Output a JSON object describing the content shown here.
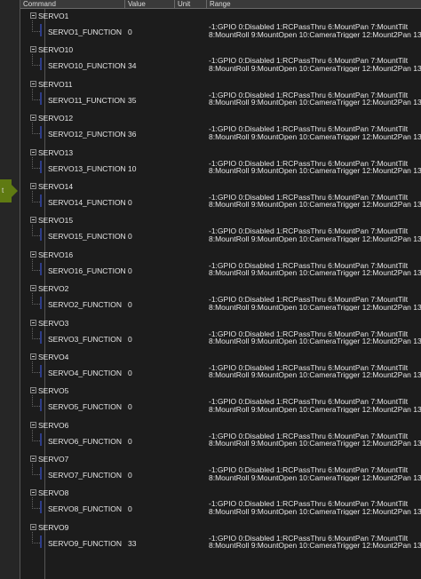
{
  "side_tab": {
    "label": "t"
  },
  "columns": {
    "command": "Command",
    "value": "Value",
    "unit": "Unit",
    "range": "Range"
  },
  "range_line1": "-1:GPIO 0:Disabled 1:RCPassThru 6:MountPan 7:MountTilt",
  "range_line2": "8:MountRoll 9:MountOpen 10:CameraTrigger 12:Mount2Pan 13:...",
  "rows": [
    {
      "group": "SERVO1",
      "name": "SERVO1_FUNCTION",
      "value": "0"
    },
    {
      "group": "SERVO10",
      "name": "SERVO10_FUNCTION",
      "value": "34"
    },
    {
      "group": "SERVO11",
      "name": "SERVO11_FUNCTION",
      "value": "35"
    },
    {
      "group": "SERVO12",
      "name": "SERVO12_FUNCTION",
      "value": "36"
    },
    {
      "group": "SERVO13",
      "name": "SERVO13_FUNCTION",
      "value": "10"
    },
    {
      "group": "SERVO14",
      "name": "SERVO14_FUNCTION",
      "value": "0"
    },
    {
      "group": "SERVO15",
      "name": "SERVO15_FUNCTION",
      "value": "0"
    },
    {
      "group": "SERVO16",
      "name": "SERVO16_FUNCTION",
      "value": "0"
    },
    {
      "group": "SERVO2",
      "name": "SERVO2_FUNCTION",
      "value": "0"
    },
    {
      "group": "SERVO3",
      "name": "SERVO3_FUNCTION",
      "value": "0"
    },
    {
      "group": "SERVO4",
      "name": "SERVO4_FUNCTION",
      "value": "0"
    },
    {
      "group": "SERVO5",
      "name": "SERVO5_FUNCTION",
      "value": "0"
    },
    {
      "group": "SERVO6",
      "name": "SERVO6_FUNCTION",
      "value": "0"
    },
    {
      "group": "SERVO7",
      "name": "SERVO7_FUNCTION",
      "value": "0"
    },
    {
      "group": "SERVO8",
      "name": "SERVO8_FUNCTION",
      "value": "0"
    },
    {
      "group": "SERVO9",
      "name": "SERVO9_FUNCTION",
      "value": "33"
    }
  ]
}
